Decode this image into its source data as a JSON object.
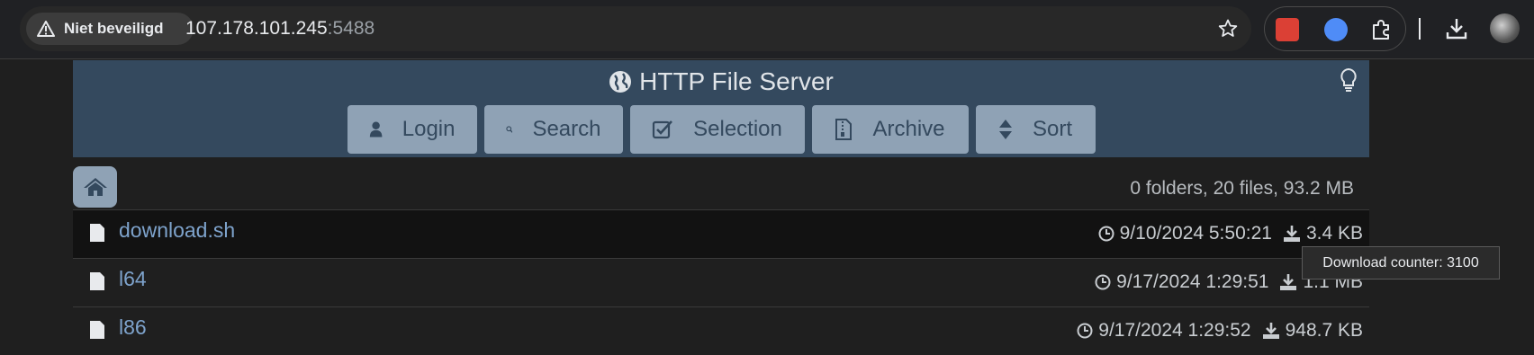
{
  "browser": {
    "security_label": "Niet beveiligd",
    "url_host": "107.178.101.245",
    "url_port": ":5488"
  },
  "page": {
    "title": "HTTP File Server",
    "toolbar": {
      "login": "Login",
      "search": "Search",
      "selection": "Selection",
      "archive": "Archive",
      "sort": "Sort"
    },
    "summary": "0 folders, 20 files, 93.2 MB",
    "files": [
      {
        "name": "download.sh",
        "date": "9/10/2024 5:50:21",
        "size": "3.4 KB"
      },
      {
        "name": "l64",
        "date": "9/17/2024 1:29:51",
        "size": "1.1 MB"
      },
      {
        "name": "l86",
        "date": "9/17/2024 1:29:52",
        "size": "948.7 KB"
      }
    ],
    "tooltip": "Download counter: 3100"
  },
  "colors": {
    "header_bg": "#34495e",
    "button_bg": "#8fa2b5",
    "link": "#7ea3cc",
    "page_bg": "#1f1f1f"
  }
}
